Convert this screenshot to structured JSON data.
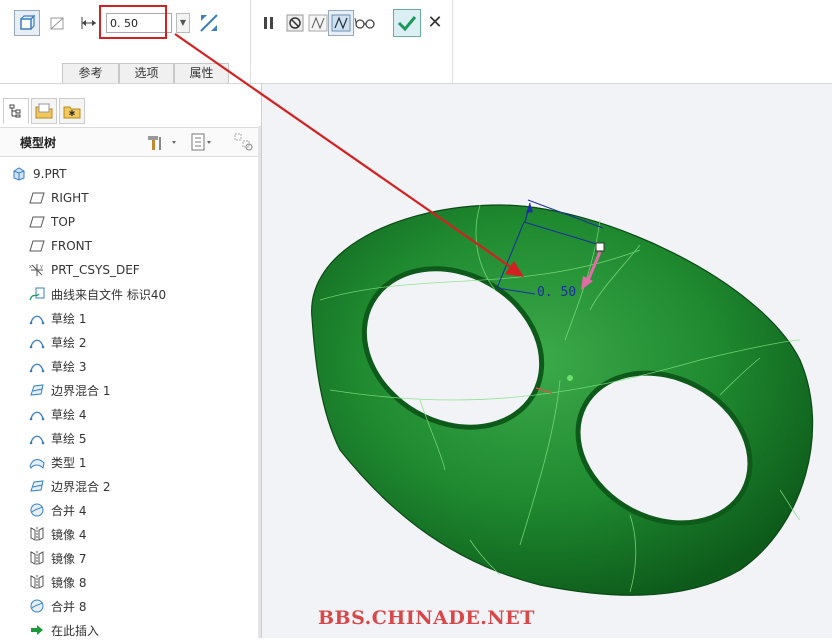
{
  "dashboard": {
    "thickness_value": "0. 50",
    "tabs": [
      "参考",
      "选项",
      "属性"
    ]
  },
  "model_tree": {
    "title": "模型树",
    "items": [
      {
        "label": "9.PRT",
        "icon": "part-icon"
      },
      {
        "label": "RIGHT",
        "icon": "datum-plane-icon"
      },
      {
        "label": "TOP",
        "icon": "datum-plane-icon"
      },
      {
        "label": "FRONT",
        "icon": "datum-plane-icon"
      },
      {
        "label": "PRT_CSYS_DEF",
        "icon": "csys-icon"
      },
      {
        "label": "曲线来自文件 标识40",
        "icon": "curve-from-file-icon"
      },
      {
        "label": "草绘 1",
        "icon": "sketch-icon"
      },
      {
        "label": "草绘 2",
        "icon": "sketch-icon"
      },
      {
        "label": "草绘 3",
        "icon": "sketch-icon"
      },
      {
        "label": "边界混合 1",
        "icon": "boundary-blend-icon"
      },
      {
        "label": "草绘 4",
        "icon": "sketch-icon"
      },
      {
        "label": "草绘 5",
        "icon": "sketch-icon"
      },
      {
        "label": "类型 1",
        "icon": "style-icon"
      },
      {
        "label": "边界混合 2",
        "icon": "boundary-blend-icon"
      },
      {
        "label": "合并 4",
        "icon": "merge-icon"
      },
      {
        "label": "镜像 4",
        "icon": "mirror-icon"
      },
      {
        "label": "镜像 7",
        "icon": "mirror-icon"
      },
      {
        "label": "镜像 8",
        "icon": "mirror-icon"
      },
      {
        "label": "合并 8",
        "icon": "merge-icon"
      },
      {
        "label": "在此插入",
        "icon": "insert-here-icon"
      }
    ]
  },
  "viewport": {
    "dimension_label": "0. 50",
    "watermark": "BBS.CHINADE.NET"
  },
  "colors": {
    "model_green": "#1f8a30",
    "annotation_red": "#d42020",
    "dimension_blue": "#1a2fa0",
    "direction_pink": "#e46aa8"
  }
}
